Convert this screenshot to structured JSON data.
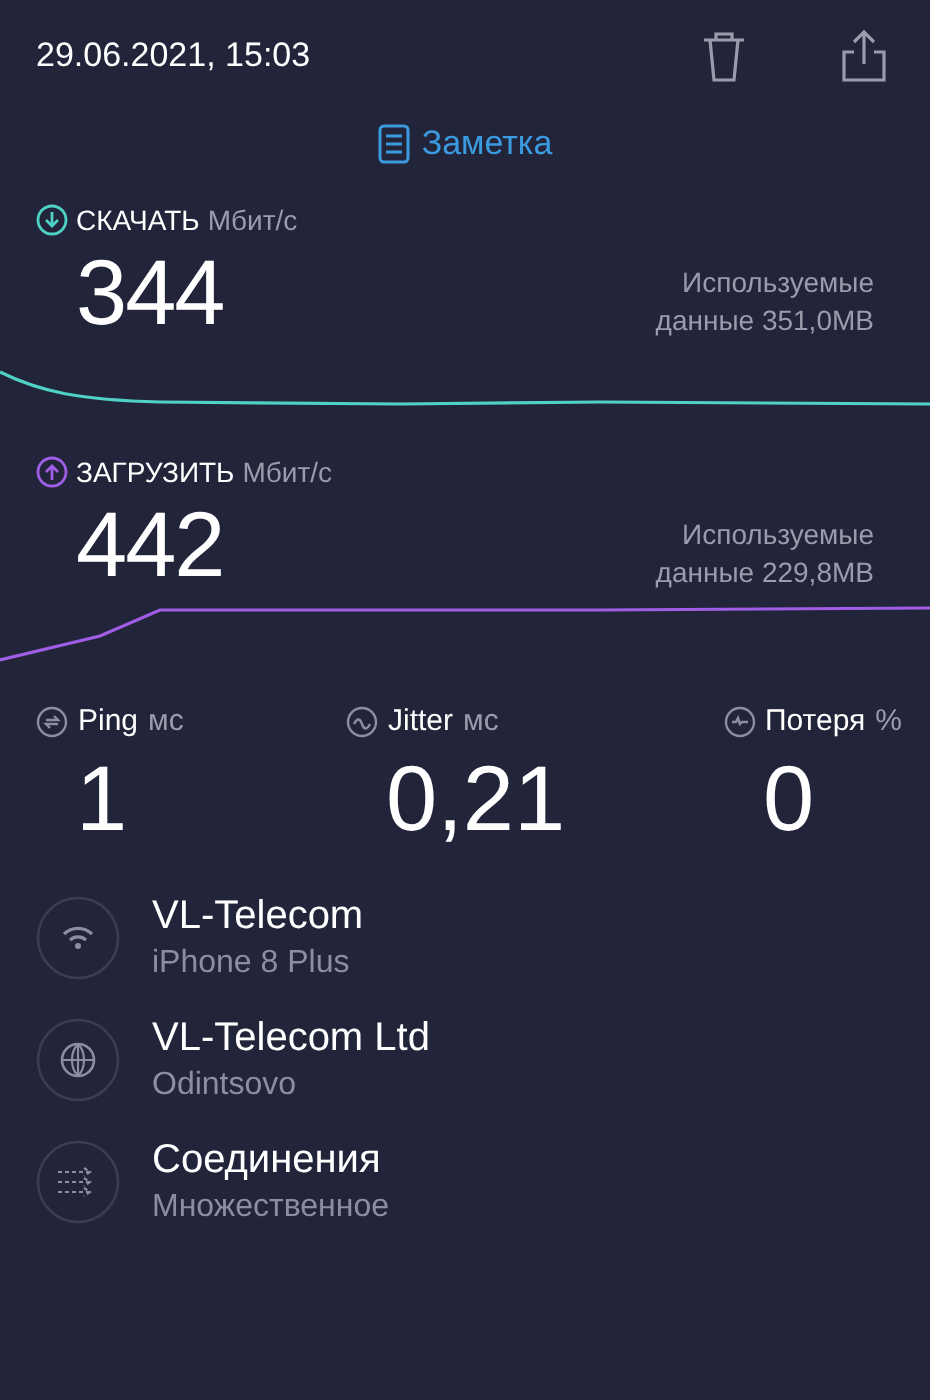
{
  "header": {
    "datetime": "29.06.2021, 15:03"
  },
  "note_button": {
    "label": "Заметка"
  },
  "speeds": [
    {
      "kind": "download",
      "label": "СКАЧАТЬ",
      "unit": "Мбит/с",
      "value": "344",
      "used_label": "Используемые",
      "used_value": "данные 351,0MB"
    },
    {
      "kind": "upload",
      "label": "ЗАГРУЗИТЬ",
      "unit": "Мбит/с",
      "value": "442",
      "used_label": "Используемые",
      "used_value": "данные 229,8MB"
    }
  ],
  "stats": [
    {
      "kind": "ping",
      "label": "Ping",
      "unit": "мс",
      "value": "1"
    },
    {
      "kind": "jitter",
      "label": "Jitter",
      "unit": "мс",
      "value": "0,21"
    },
    {
      "kind": "loss",
      "label": "Потеря",
      "unit": "%",
      "value": "0"
    }
  ],
  "info": [
    {
      "kind": "wifi",
      "title": "VL-Telecom",
      "subtitle": "iPhone 8 Plus"
    },
    {
      "kind": "globe",
      "title": "VL-Telecom Ltd",
      "subtitle": "Odintsovo"
    },
    {
      "kind": "connections",
      "title": "Соединения",
      "subtitle": "Множественное"
    }
  ]
}
